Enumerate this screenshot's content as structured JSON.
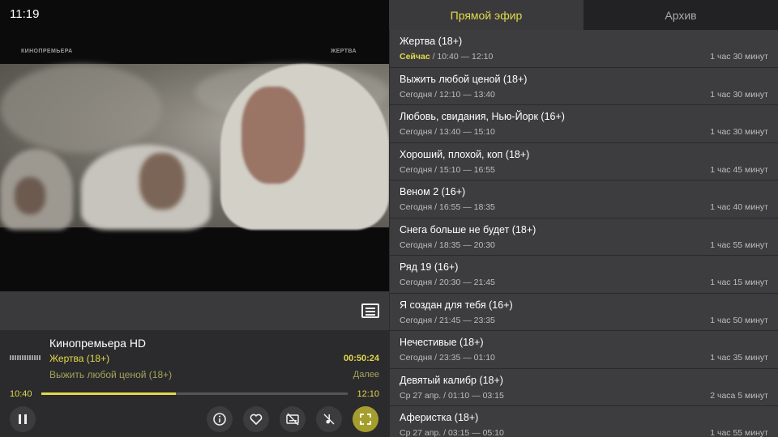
{
  "clock": "11:19",
  "video": {
    "channel_watermark": "КИНОПРЕМЬЕРА",
    "title_watermark": "ЖЕРТВА"
  },
  "player": {
    "channel_name": "Кинопремьера HD",
    "current_program": "Жертва (18+)",
    "next_program": "Выжить любой ценой (18+)",
    "remaining_time": "00:50:24",
    "next_label": "Далее",
    "start_time": "10:40",
    "end_time": "12:10",
    "progress_fraction": 0.44,
    "controls": {
      "pause": "pause-icon",
      "info": "info-icon",
      "favorite": "heart-icon",
      "subtitles": "subtitles-off-icon",
      "audio": "audio-off-icon",
      "fullscreen": "fullscreen-icon"
    }
  },
  "epg": {
    "tabs": [
      {
        "label": "Прямой эфир",
        "active": true
      },
      {
        "label": "Архив",
        "active": false
      }
    ],
    "items": [
      {
        "title": "Жертва (18+)",
        "day": "Сейчас",
        "time": " / 10:40 — 12:10",
        "duration": "1 час 30 минут",
        "now": true
      },
      {
        "title": "Выжить любой ценой (18+)",
        "day": "Сегодня",
        "time": " / 12:10 — 13:40",
        "duration": "1 час 30 минут"
      },
      {
        "title": "Любовь, свидания, Нью-Йорк (16+)",
        "day": "Сегодня",
        "time": " / 13:40 — 15:10",
        "duration": "1 час 30 минут"
      },
      {
        "title": "Хороший, плохой, коп (18+)",
        "day": "Сегодня",
        "time": " / 15:10 — 16:55",
        "duration": "1 час 45 минут"
      },
      {
        "title": "Веном 2 (16+)",
        "day": "Сегодня",
        "time": " / 16:55 — 18:35",
        "duration": "1 час 40 минут"
      },
      {
        "title": "Снега больше не будет (18+)",
        "day": "Сегодня",
        "time": " / 18:35 — 20:30",
        "duration": "1 час 55 минут"
      },
      {
        "title": "Ряд 19 (16+)",
        "day": "Сегодня",
        "time": " / 20:30 — 21:45",
        "duration": "1 час 15 минут"
      },
      {
        "title": "Я создан для тебя (16+)",
        "day": "Сегодня",
        "time": " / 21:45 — 23:35",
        "duration": "1 час 50 минут"
      },
      {
        "title": "Нечестивые (18+)",
        "day": "Сегодня",
        "time": " / 23:35 — 01:10",
        "duration": "1 час 35 минут"
      },
      {
        "title": "Девятый калибр (18+)",
        "day": "Ср 27 апр.",
        "time": " / 01:10 — 03:15",
        "duration": "2 часа 5 минут"
      },
      {
        "title": "Аферистка (18+)",
        "day": "Ср 27 апр.",
        "time": " / 03:15 — 05:10",
        "duration": "1 час 55 минут"
      }
    ]
  }
}
